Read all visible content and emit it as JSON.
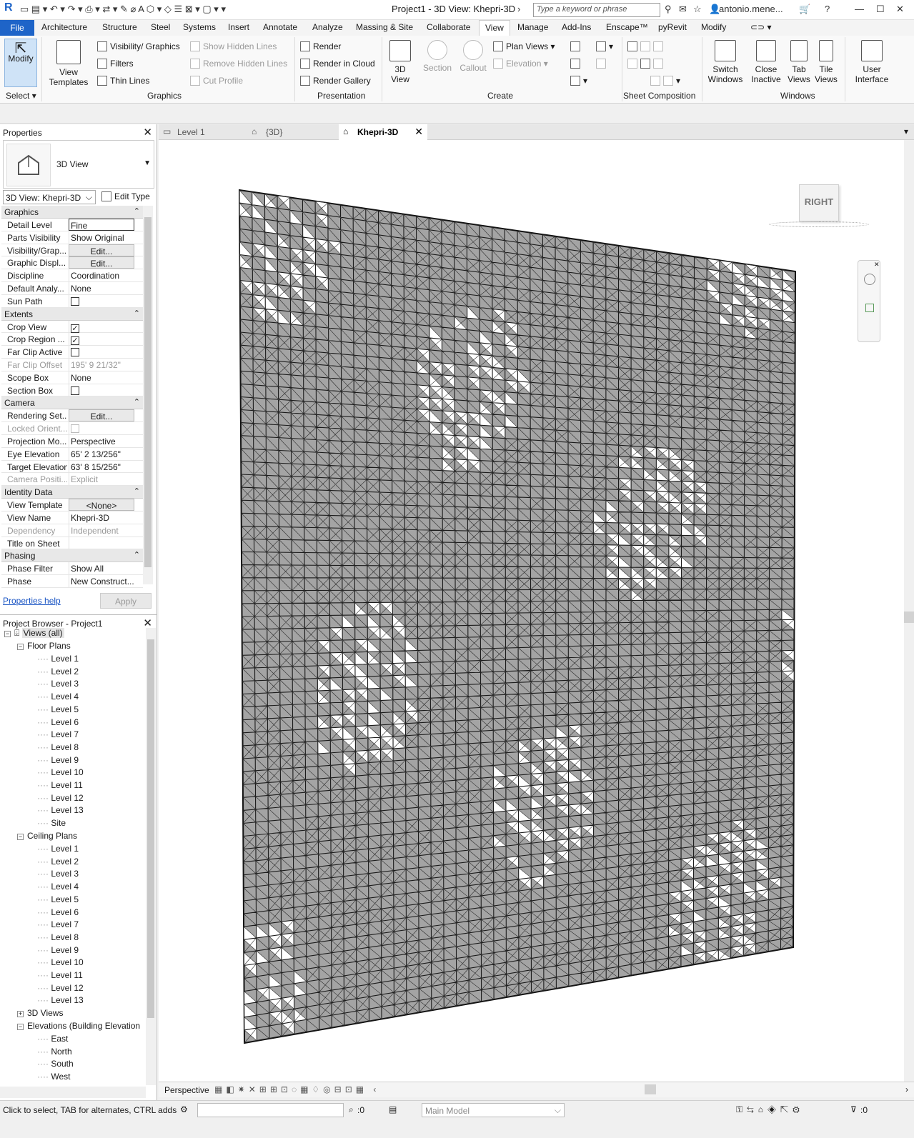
{
  "titlebar": {
    "title": "Project1 - 3D View: Khepri-3D",
    "search_placeholder": "Type a keyword or phrase",
    "user": "antonio.mene...",
    "help": "?"
  },
  "ribbon_tabs": [
    {
      "label": "File"
    },
    {
      "label": "Architecture"
    },
    {
      "label": "Structure"
    },
    {
      "label": "Steel"
    },
    {
      "label": "Systems"
    },
    {
      "label": "Insert"
    },
    {
      "label": "Annotate"
    },
    {
      "label": "Analyze"
    },
    {
      "label": "Massing & Site"
    },
    {
      "label": "Collaborate"
    },
    {
      "label": "View"
    },
    {
      "label": "Manage"
    },
    {
      "label": "Add-Ins"
    },
    {
      "label": "Enscape™"
    },
    {
      "label": "pyRevit"
    },
    {
      "label": "Modify"
    }
  ],
  "ribbon": {
    "modify": "Modify",
    "select": "Select",
    "view_templates": "View Templates",
    "visibility_graphics": "Visibility/ Graphics",
    "filters": "Filters",
    "thin_lines": "Thin  Lines",
    "show_hidden_lines": "Show  Hidden Lines",
    "remove_hidden_lines": "Remove  Hidden Lines",
    "cut_profile": "Cut  Profile",
    "graphics_group": "Graphics",
    "render": "Render",
    "render_in_cloud": "Render  in Cloud",
    "render_gallery": "Render  Gallery",
    "presentation_group": "Presentation",
    "view_3d": "3D View",
    "section": "Section",
    "callout": "Callout",
    "plan_views": "Plan  Views",
    "elevation": "Elevation",
    "create_group": "Create",
    "sheet_composition_group": "Sheet Composition",
    "switch_windows": "Switch Windows",
    "close_inactive": "Close Inactive",
    "tab_views": "Tab Views",
    "tile_views": "Tile Views",
    "user_interface": "User Interface",
    "windows_group": "Windows"
  },
  "properties": {
    "title": "Properties",
    "type_name": "3D View",
    "view_selector": "3D View: Khepri-3D",
    "edit_type": "Edit Type",
    "help": "Properties help",
    "apply": "Apply",
    "sections": {
      "graphics": "Graphics",
      "extents": "Extents",
      "camera": "Camera",
      "identity": "Identity Data",
      "phasing": "Phasing"
    },
    "rows": {
      "detail_level": {
        "k": "Detail Level",
        "v": "Fine"
      },
      "parts_visibility": {
        "k": "Parts Visibility",
        "v": "Show Original"
      },
      "visibility_graphics": {
        "k": "Visibility/Grap...",
        "v": "Edit..."
      },
      "graphic_display": {
        "k": "Graphic Displ...",
        "v": "Edit..."
      },
      "discipline": {
        "k": "Discipline",
        "v": "Coordination"
      },
      "default_analysis": {
        "k": "Default Analy...",
        "v": "None"
      },
      "sun_path": {
        "k": "Sun Path",
        "v": ""
      },
      "crop_view": {
        "k": "Crop View",
        "v": "✓"
      },
      "crop_region": {
        "k": "Crop Region ...",
        "v": "✓"
      },
      "far_clip_active": {
        "k": "Far Clip Active",
        "v": ""
      },
      "far_clip_offset": {
        "k": "Far Clip Offset",
        "v": "195'  9 21/32\""
      },
      "scope_box": {
        "k": "Scope Box",
        "v": "None"
      },
      "section_box": {
        "k": "Section Box",
        "v": ""
      },
      "rendering_settings": {
        "k": "Rendering Set...",
        "v": "Edit..."
      },
      "locked_orientation": {
        "k": "Locked Orient...",
        "v": ""
      },
      "projection_mode": {
        "k": "Projection Mo...",
        "v": "Perspective"
      },
      "eye_elevation": {
        "k": "Eye Elevation",
        "v": "65'  2 13/256\""
      },
      "target_elevation": {
        "k": "Target Elevation",
        "v": "63'  8 15/256\""
      },
      "camera_position": {
        "k": "Camera Positi...",
        "v": "Explicit"
      },
      "view_template": {
        "k": "View Template",
        "v": "<None>"
      },
      "view_name": {
        "k": "View Name",
        "v": "Khepri-3D"
      },
      "dependency": {
        "k": "Dependency",
        "v": "Independent"
      },
      "title_on_sheet": {
        "k": "Title on Sheet",
        "v": ""
      },
      "phase_filter": {
        "k": "Phase Filter",
        "v": "Show All"
      },
      "phase": {
        "k": "Phase",
        "v": "New Construct..."
      }
    }
  },
  "browser": {
    "title": "Project Browser - Project1",
    "views_all": "Views (all)",
    "floor_plans": "Floor Plans",
    "floor_items": [
      "Level 1",
      "Level 2",
      "Level 3",
      "Level 4",
      "Level 5",
      "Level 6",
      "Level 7",
      "Level 8",
      "Level 9",
      "Level 10",
      "Level 11",
      "Level 12",
      "Level 13",
      "Site"
    ],
    "ceiling_plans": "Ceiling Plans",
    "ceiling_items": [
      "Level 1",
      "Level 2",
      "Level 3",
      "Level 4",
      "Level 5",
      "Level 6",
      "Level 7",
      "Level 8",
      "Level 9",
      "Level 10",
      "Level 11",
      "Level 12",
      "Level 13"
    ],
    "views_3d": "3D Views",
    "elevations": "Elevations (Building Elevation",
    "elevation_items": [
      "East",
      "North",
      "South",
      "West"
    ]
  },
  "view_tabs": [
    {
      "label": "Level 1"
    },
    {
      "label": "{3D}"
    },
    {
      "label": "Khepri-3D"
    }
  ],
  "viewcube": {
    "face": "RIGHT"
  },
  "view_control": {
    "mode": "Perspective"
  },
  "status": {
    "message": "Click to select, TAB for alternates, CTRL adds, S",
    "coord": ":0",
    "model": "Main Model",
    "filter_count": ":0"
  },
  "colors": {
    "file_tab": "#1e64c8",
    "panel_fill": "#a4a4a4",
    "line": "#111111"
  }
}
